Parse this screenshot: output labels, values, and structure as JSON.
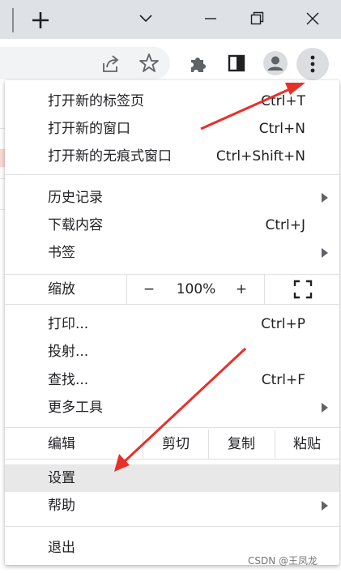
{
  "menu": {
    "new_tab": {
      "label": "打开新的标签页",
      "shortcut": "Ctrl+T"
    },
    "new_window": {
      "label": "打开新的窗口",
      "shortcut": "Ctrl+N"
    },
    "new_incognito": {
      "label": "打开新的无痕式窗口",
      "shortcut": "Ctrl+Shift+N"
    },
    "history": {
      "label": "历史记录"
    },
    "downloads": {
      "label": "下载内容",
      "shortcut": "Ctrl+J"
    },
    "bookmarks": {
      "label": "书签"
    },
    "zoom": {
      "label": "缩放",
      "minus": "−",
      "value": "100%",
      "plus": "+"
    },
    "print": {
      "label": "打印...",
      "shortcut": "Ctrl+P"
    },
    "cast": {
      "label": "投射..."
    },
    "find": {
      "label": "查找...",
      "shortcut": "Ctrl+F"
    },
    "more_tools": {
      "label": "更多工具"
    },
    "edit": {
      "label": "编辑",
      "cut": "剪切",
      "copy": "复制",
      "paste": "粘贴"
    },
    "settings": {
      "label": "设置"
    },
    "help": {
      "label": "帮助"
    },
    "exit": {
      "label": "退出"
    }
  },
  "watermark": "CSDN @王凤龙",
  "colors": {
    "titlebar": "#dee1e6",
    "highlight": "#e8e8e9",
    "annotation_arrow": "#e8302a"
  },
  "icons": {
    "new_tab": "plus-icon",
    "tab_search": "chevron-down-icon",
    "minimize": "minimize-icon",
    "restore": "restore-icon",
    "close": "close-icon",
    "share": "share-icon",
    "bookmark": "star-icon",
    "extensions": "puzzle-icon",
    "side_panel": "side-panel-icon",
    "profile": "profile-icon",
    "menu": "kebab-menu-icon",
    "fullscreen": "fullscreen-icon"
  }
}
